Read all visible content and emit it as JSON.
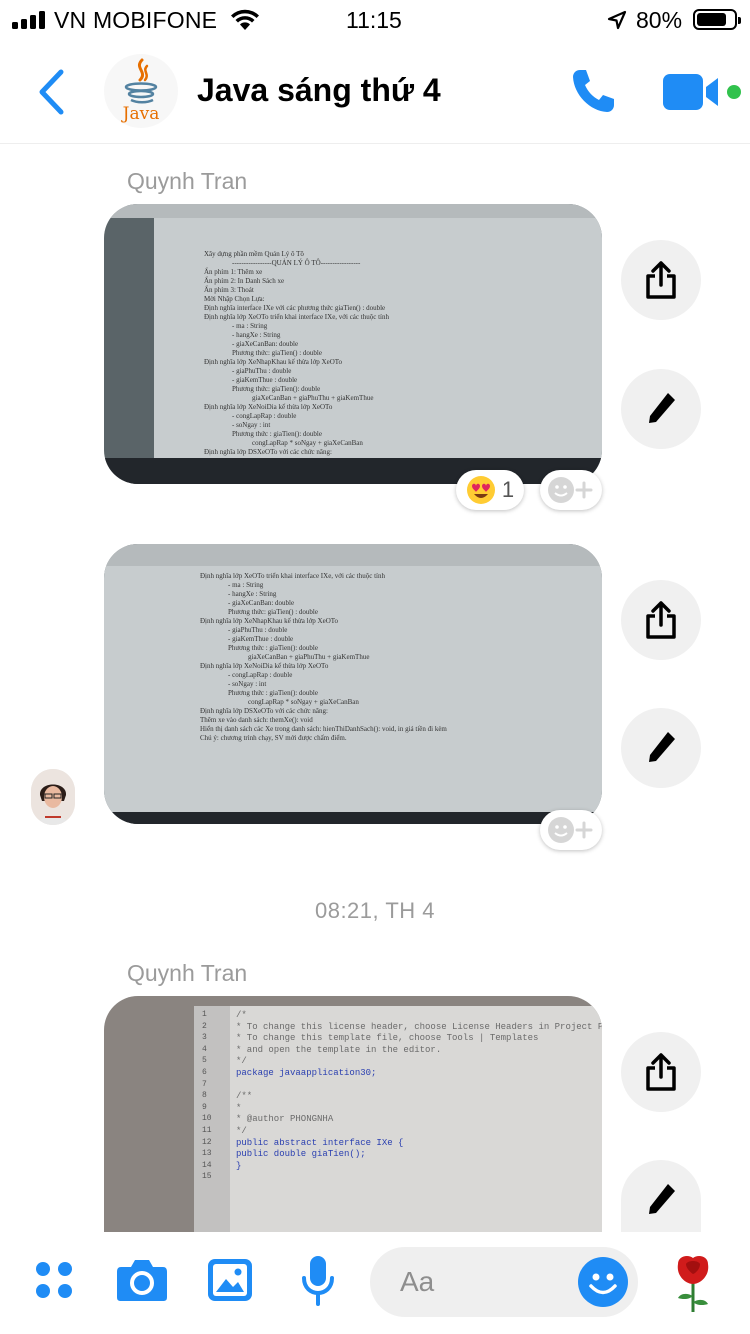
{
  "status_bar": {
    "carrier": "VN MOBIFONE",
    "time": "11:15",
    "battery": "80%",
    "battery_level": 0.8
  },
  "header": {
    "title": "Java sáng thứ 4",
    "avatar_text": "Java",
    "icons": [
      "chevron-left-icon",
      "java-logo",
      "phone-icon",
      "video-camera-icon",
      "online-dot"
    ]
  },
  "colors": {
    "accent": "#1f8cf5",
    "online": "#31c24d",
    "reaction_bg": "#ffffff"
  },
  "messages": [
    {
      "sender": "Quynh Tran",
      "type": "photo",
      "reaction": {
        "emoji": "heart-eyes-icon",
        "count": "1"
      },
      "doc_lines": [
        "Xây dựng phần mềm Quản Lý ô Tô",
        "-----------------QUẢN LÝ Ô TÔ-----------------",
        "Ấn phím 1: Thêm xe",
        "Ấn phím 2: In Danh Sách xe",
        "Ấn phím 3: Thoát",
        "Mời Nhập Chọn Lựa:",
        "Định nghĩa interface IXe với các phương thức giaTien() : double",
        "Định nghĩa lớp XeOTo triển khai interface IXe, với các thuộc tính",
        "- ma : String",
        "- hangXe : String",
        "- giaXeCanBan: double",
        "Phương thức: giaTien() : double",
        "Định nghĩa lớp XeNhapKhau kế thừa lớp XeOTo",
        "- giaPhuThu : double",
        "- giaKemThue : double",
        "Phương thức: giaTien(): double",
        "giaXeCanBan + giaPhuThu + giaKemThue",
        "Định nghĩa lớp XeNoiDia kế thừa lớp XeOTo",
        "- congLapRap : double",
        "- soNgay : int",
        "Phương thức : giaTien(): double",
        "congLapRap * soNgay + giaXeCanBan",
        "Định nghĩa lớp DSXeOTo với các chức năng:"
      ]
    },
    {
      "sender": "",
      "type": "photo",
      "doc_lines": [
        "Định nghĩa lớp XeOTo triển khai interface IXe, với các thuộc tính",
        "- ma : String",
        "- hangXe : String",
        "- giaXeCanBan: double",
        "Phương thức: giaTien() : double",
        "Định nghĩa lớp XeNhapKhau kế thừa lớp XeOTo",
        "- giaPhuThu : double",
        "- giaKemThue : double",
        "Phương thức : giaTien(): double",
        "giaXeCanBan + giaPhuThu + giaKemThue",
        "Định nghĩa lớp XeNoiDia kế thừa lớp XeOTo",
        "- congLapRap : double",
        "- soNgay : int",
        "Phương thức : giaTien(): double",
        "congLapRap * soNgay + giaXeCanBan",
        "Định nghĩa lớp DSXeOTo với các chức năng:",
        "Thêm xe vào danh sách:   themXe(): void",
        "Hiển thị danh sách các Xe trong danh sách: hienThiDanhSach(): void, in giá tiền đi kèm",
        "Chú ý: chương trình chạy, SV mới được chấm điểm."
      ]
    }
  ],
  "time_separator": "08:21, TH 4",
  "code_message": {
    "sender": "Quynh Tran",
    "type": "photo",
    "lines": [
      {
        "no": "1",
        "text": "/*",
        "kind": "comment"
      },
      {
        "no": "2",
        "text": " * To change this license header, choose License Headers in Project Propert",
        "kind": "comment"
      },
      {
        "no": "3",
        "text": " * To change this template file, choose Tools | Templates",
        "kind": "comment"
      },
      {
        "no": "4",
        "text": " * and open the template in the editor.",
        "kind": "comment"
      },
      {
        "no": "5",
        "text": " */",
        "kind": "comment"
      },
      {
        "no": "6",
        "text": "package javaapplication30;",
        "kind": "code"
      },
      {
        "no": "7",
        "text": "",
        "kind": "code"
      },
      {
        "no": "8",
        "text": "/**",
        "kind": "comment"
      },
      {
        "no": "9",
        "text": " *",
        "kind": "comment"
      },
      {
        "no": "10",
        "text": " * @author PHONGNHA",
        "kind": "comment"
      },
      {
        "no": "11",
        "text": " */",
        "kind": "comment"
      },
      {
        "no": "12",
        "text": "public abstract interface IXe {",
        "kind": "code"
      },
      {
        "no": "13",
        "text": "    public double giaTien();",
        "kind": "code"
      },
      {
        "no": "14",
        "text": "}",
        "kind": "code"
      },
      {
        "no": "15",
        "text": "",
        "kind": "code"
      }
    ]
  },
  "composer": {
    "placeholder": "Aa",
    "icons": [
      "apps-icon",
      "camera-icon",
      "image-icon",
      "microphone-icon",
      "emoji-icon",
      "rose-icon"
    ]
  }
}
